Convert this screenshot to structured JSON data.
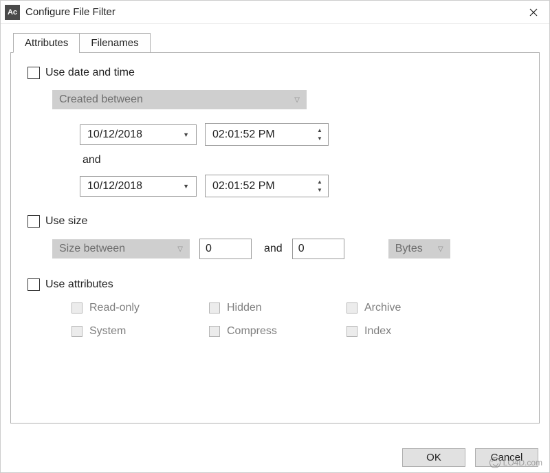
{
  "title": "Configure File Filter",
  "app_icon_text": "Ac",
  "tabs": {
    "attributes": "Attributes",
    "filenames": "Filenames"
  },
  "date": {
    "use_label": "Use date and time",
    "created_between": "Created between",
    "from_date": "10/12/2018",
    "from_time": "02:01:52  PM",
    "and": "and",
    "to_date": "10/12/2018",
    "to_time": "02:01:52  PM"
  },
  "size": {
    "use_label": "Use size",
    "size_between": "Size between",
    "from": "0",
    "and": "and",
    "to": "0",
    "unit": "Bytes"
  },
  "attrs": {
    "use_label": "Use attributes",
    "readonly": "Read-only",
    "hidden": "Hidden",
    "archive": "Archive",
    "system": "System",
    "compress": "Compress",
    "index": "Index"
  },
  "buttons": {
    "ok": "OK",
    "cancel": "Cancel"
  },
  "watermark": "LO4D.com"
}
